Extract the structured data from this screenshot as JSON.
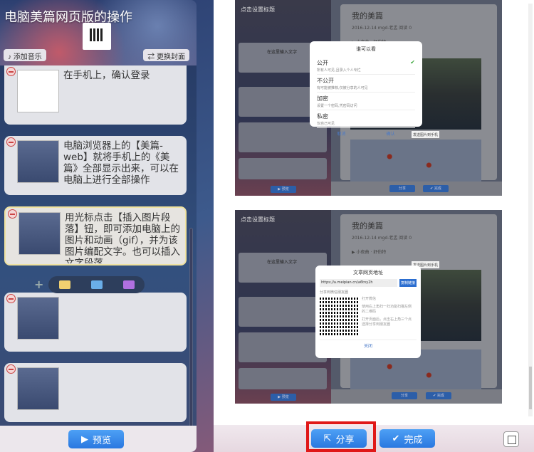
{
  "left_panel": {
    "title": "电脑美篇网页版的操作",
    "add_music": "♪ 添加音乐",
    "change_cover": "⇄ 更换封面",
    "cards": [
      {
        "text": "在手机上，确认登录"
      },
      {
        "text": "电脑浏览器上的【美篇-web】就将手机上的《美篇》全部显示出来，可以在电脑上进行全部操作"
      },
      {
        "text": "用光标点击【插入图片段落】钮，即可添加电脑上的图片和动画（gif），并为该图片编配文字。也可以插入文字段落..."
      },
      {
        "text": ""
      },
      {
        "text": ""
      }
    ],
    "preview_label": "预览"
  },
  "screenshot1": {
    "cover_title": "点击设置标题",
    "article_title": "我的美篇",
    "meta": "2016-12-14  mgd-老孟  阅读 0",
    "music": "▶ 小夜曲 · 舒伯特",
    "para_text": "在这里输入文字",
    "dialog": {
      "title": "谁可以看",
      "options": [
        {
          "label": "公开",
          "desc": "所有人可见,且录入个人专栏",
          "checked": true
        },
        {
          "label": "不公开",
          "desc": "有可能被推荐,仅被分享的人可见",
          "checked": false
        },
        {
          "label": "加密",
          "desc": "设置一个密码,凭密码访问",
          "checked": false
        },
        {
          "label": "私密",
          "desc": "仅自己可见",
          "checked": false
        }
      ],
      "cancel": "取消",
      "confirm": "确认"
    },
    "send_to_phone": "发送图片到手机",
    "preview": "▶ 预览",
    "share": "分享",
    "done": "✔ 完成"
  },
  "screenshot2": {
    "cover_title": "点击设置标题",
    "article_title": "我的美篇",
    "meta": "2016-12-14  mgd-老孟  阅读 0",
    "music": "▶ 小夜曲 · 舒伯特",
    "para_text": "在这里输入文字",
    "dialog": {
      "title": "文章网页地址",
      "url": "https://a.meipian.cn/a6tny2h",
      "copy": "复制链接",
      "share_title": "分享到微信朋友圈",
      "steps": [
        "打开微信",
        "使用右上角扫一扫功能扫描左侧的二维码",
        "打开页面后，点击右上角三个点选择分享到朋友圈"
      ],
      "close": "关闭"
    },
    "send_to_phone": "发送图片到手机",
    "preview": "▶ 预览",
    "share": "分享",
    "done": "✔ 完成"
  },
  "footer": {
    "share_label": "分享",
    "done_label": "完成"
  },
  "colors": {
    "button_blue": "#2a78e0",
    "highlight_red": "#e01818"
  }
}
